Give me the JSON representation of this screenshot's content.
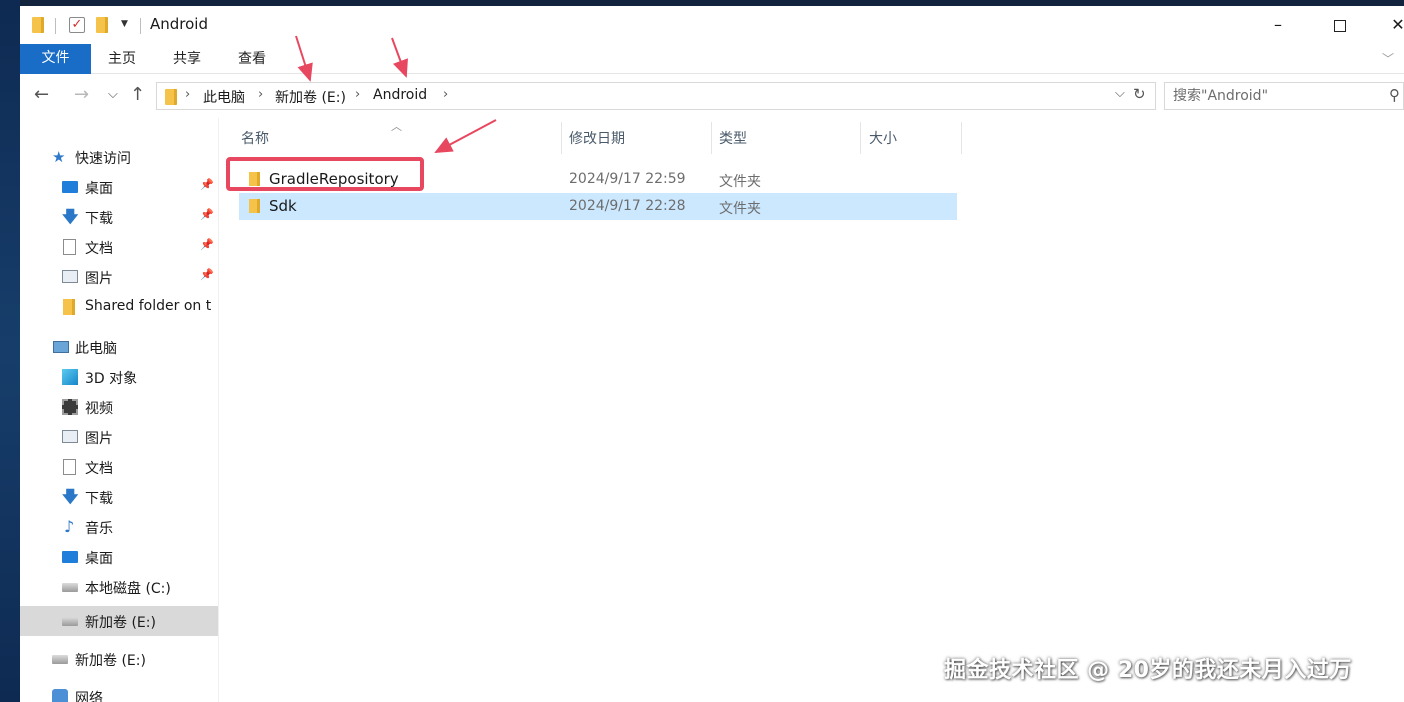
{
  "window": {
    "title": "Android",
    "minimize_label": "–",
    "close_label": "✕"
  },
  "ribbon": {
    "tabs": [
      "文件",
      "主页",
      "共享",
      "查看"
    ]
  },
  "address": {
    "crumbs": [
      "此电脑",
      "新加卷 (E:)",
      "Android"
    ],
    "search_placeholder": "搜索\"Android\""
  },
  "sidebar": {
    "items": [
      {
        "label": "快速访问",
        "icon": "star-icon"
      },
      {
        "label": "桌面",
        "icon": "desktop-icon"
      },
      {
        "label": "下载",
        "icon": "download-icon"
      },
      {
        "label": "文档",
        "icon": "document-icon"
      },
      {
        "label": "图片",
        "icon": "picture-icon"
      },
      {
        "label": "Shared folder on t",
        "icon": "folder-icon"
      },
      {
        "label": "此电脑",
        "icon": "computer-icon"
      },
      {
        "label": "3D 对象",
        "icon": "3d-objects-icon"
      },
      {
        "label": "视频",
        "icon": "video-icon"
      },
      {
        "label": "图片",
        "icon": "picture-icon"
      },
      {
        "label": "文档",
        "icon": "document-icon"
      },
      {
        "label": "下载",
        "icon": "download-icon"
      },
      {
        "label": "音乐",
        "icon": "music-icon"
      },
      {
        "label": "桌面",
        "icon": "desktop-icon"
      },
      {
        "label": "本地磁盘 (C:)",
        "icon": "drive-icon"
      },
      {
        "label": "新加卷 (E:)",
        "icon": "drive-icon"
      },
      {
        "label": "新加卷 (E:)",
        "icon": "drive-icon"
      },
      {
        "label": "网络",
        "icon": "network-icon"
      }
    ]
  },
  "columns": {
    "name": "名称",
    "date": "修改日期",
    "type": "类型",
    "size": "大小"
  },
  "files": [
    {
      "name": "GradleRepository",
      "date": "2024/9/17 22:59",
      "type": "文件夹"
    },
    {
      "name": "Sdk",
      "date": "2024/9/17 22:28",
      "type": "文件夹"
    }
  ],
  "watermark": "掘金技术社区 @ 20岁的我还未月入过万",
  "colors": {
    "accent": "#1a6dc6",
    "selection": "#cce8ff",
    "highlight": "#e8485f"
  }
}
